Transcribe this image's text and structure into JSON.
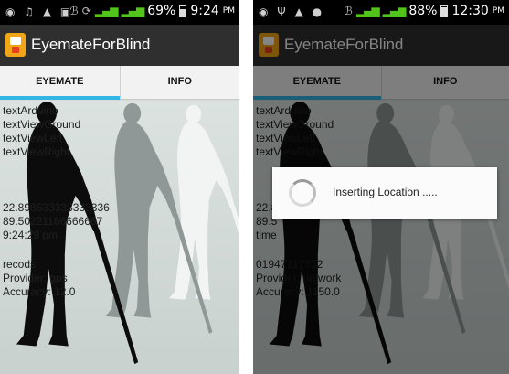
{
  "screens": [
    {
      "status": {
        "battery": "69%",
        "time": "9:24",
        "ampm": "PM",
        "battery_level": 0.69
      },
      "app_title": "EyemateForBlind",
      "tabs": [
        {
          "label": "EYEMATE",
          "selected": true
        },
        {
          "label": "INFO",
          "selected": false
        }
      ],
      "lines_top": [
        "textArduino",
        "textViewGround",
        "textViewLeft",
        "textViewRight"
      ],
      "lines_mid": [
        "22.898633333333336",
        "89.50221166666667",
        "9:24:29 pm"
      ],
      "lines_bottom": [
        "recods",
        "Provider: gps",
        "Accuracy: 12.0"
      ]
    },
    {
      "status": {
        "battery": "88%",
        "time": "12:30",
        "ampm": "PM",
        "battery_level": 0.88
      },
      "app_title": "EyemateForBlind",
      "tabs": [
        {
          "label": "EYEMATE",
          "selected": true
        },
        {
          "label": "INFO",
          "selected": false
        }
      ],
      "lines_top": [
        "textArduino",
        "textViewGround",
        "textViewLeft",
        "textViewRight"
      ],
      "lines_mid": [
        "22.8",
        "89.5",
        "time"
      ],
      "lines_bottom": [
        "01947717712",
        "Provider: network",
        "Accuracy: 1150.0"
      ],
      "dialog": {
        "message": "Inserting Location ....."
      }
    }
  ],
  "colors": {
    "accent": "#33b5e5",
    "actionbar": "#2f2f2f",
    "signal": "#52c41a",
    "app_icon": "#f2a516"
  }
}
